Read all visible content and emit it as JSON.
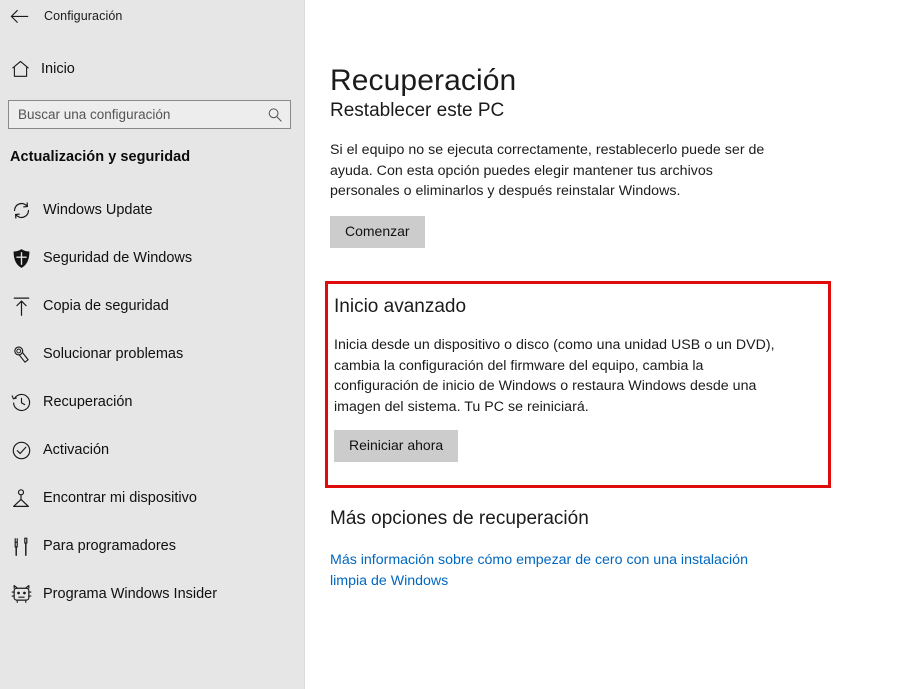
{
  "window": {
    "back_label": "back-arrow",
    "title": "Configuración"
  },
  "sidebar": {
    "home_label": "Inicio",
    "search": {
      "placeholder": "Buscar una configuración",
      "value": ""
    },
    "category_header": "Actualización y seguridad",
    "items": [
      {
        "label": "Windows Update",
        "icon": "refresh-icon"
      },
      {
        "label": "Seguridad de Windows",
        "icon": "shield-icon"
      },
      {
        "label": "Copia de seguridad",
        "icon": "upload-arrow-icon"
      },
      {
        "label": "Solucionar problemas",
        "icon": "wrench-icon"
      },
      {
        "label": "Recuperación",
        "icon": "history-clock-icon"
      },
      {
        "label": "Activación",
        "icon": "check-circle-icon"
      },
      {
        "label": "Encontrar mi dispositivo",
        "icon": "location-pin-icon"
      },
      {
        "label": "Para programadores",
        "icon": "tools-icon"
      },
      {
        "label": "Programa Windows Insider",
        "icon": "insider-cat-icon"
      }
    ]
  },
  "main": {
    "page_title": "Recuperación",
    "reset_pc": {
      "heading": "Restablecer este PC",
      "description": "Si el equipo no se ejecuta correctamente, restablecerlo puede ser de ayuda. Con esta opción puedes elegir mantener tus archivos personales o eliminarlos y después reinstalar Windows.",
      "button_label": "Comenzar"
    },
    "advanced_startup": {
      "heading": "Inicio avanzado",
      "description": "Inicia desde un dispositivo o disco (como una unidad USB o un DVD), cambia la configuración del firmware del equipo, cambia la configuración de inicio de Windows o restaura Windows desde una imagen del sistema. Tu PC se reiniciará.",
      "button_label": "Reiniciar ahora",
      "highlight_color": "#e00b0b"
    },
    "more_options": {
      "heading": "Más opciones de recuperación",
      "link_text": "Más información sobre cómo empezar de cero con una instalación limpia de Windows",
      "link_color": "#0067c0"
    }
  },
  "theme": {
    "sidebar_bg": "#e6e6e6",
    "content_bg": "#ffffff",
    "button_bg": "#cccccc",
    "text_color": "#1b1b1b"
  }
}
